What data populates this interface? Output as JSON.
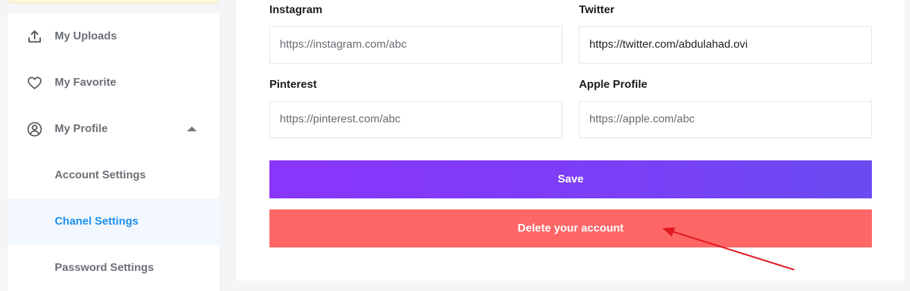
{
  "sidebar": {
    "items": [
      {
        "label": "My Uploads",
        "icon": "upload-icon"
      },
      {
        "label": "My Favorite",
        "icon": "heart-icon"
      },
      {
        "label": "My Profile",
        "icon": "user-circle-icon"
      },
      {
        "label": "Account Settings"
      },
      {
        "label": "Chanel Settings"
      },
      {
        "label": "Password Settings"
      }
    ]
  },
  "form": {
    "instagram": {
      "label": "Instagram",
      "value": "",
      "placeholder": "https://instagram.com/abc"
    },
    "twitter": {
      "label": "Twitter",
      "value": "https://twitter.com/abdulahad.ovi",
      "placeholder": ""
    },
    "pinterest": {
      "label": "Pinterest",
      "value": "",
      "placeholder": "https://pinterest.com/abc"
    },
    "apple": {
      "label": "Apple Profile",
      "value": "",
      "placeholder": "https://apple.com/abc"
    }
  },
  "buttons": {
    "save_label": "Save",
    "delete_label": "Delete your account"
  },
  "colors": {
    "accent": "#1d8ff0",
    "save_gradient_start": "#8a35fb",
    "save_gradient_end": "#6a4bf0",
    "delete": "#ff6666",
    "annotation_arrow": "#e0191f"
  }
}
